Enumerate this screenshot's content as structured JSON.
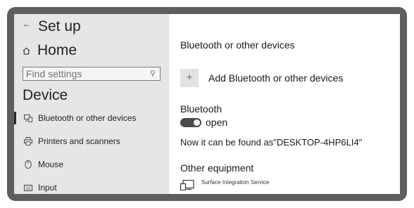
{
  "sidebar": {
    "back_icon": "back-arrow-icon",
    "title": "Set up",
    "home_label": "Home",
    "search_placeholder": "Find settings",
    "section_title": "Device",
    "items": [
      {
        "label": "Bluetooth or other devices",
        "icon": "bluetooth-devices-icon",
        "selected": true
      },
      {
        "label": "Printers and scanners",
        "icon": "printer-icon",
        "selected": false
      },
      {
        "label": "Mouse",
        "icon": "mouse-icon",
        "selected": false
      },
      {
        "label": "Input",
        "icon": "keyboard-icon",
        "selected": false
      }
    ]
  },
  "content": {
    "heading": "Bluetooth or other devices",
    "add_button_label": "Add Bluetooth or other devices",
    "bluetooth_label": "Bluetooth",
    "bluetooth_state": "open",
    "bluetooth_on": true,
    "discoverable_text": "Now it can be found as\"DESKTOP-4HP6LI4\"",
    "other_equipment_title": "Other equipment",
    "devices": [
      {
        "name": "Surface Integration Service",
        "icon": "device-icon"
      }
    ]
  }
}
